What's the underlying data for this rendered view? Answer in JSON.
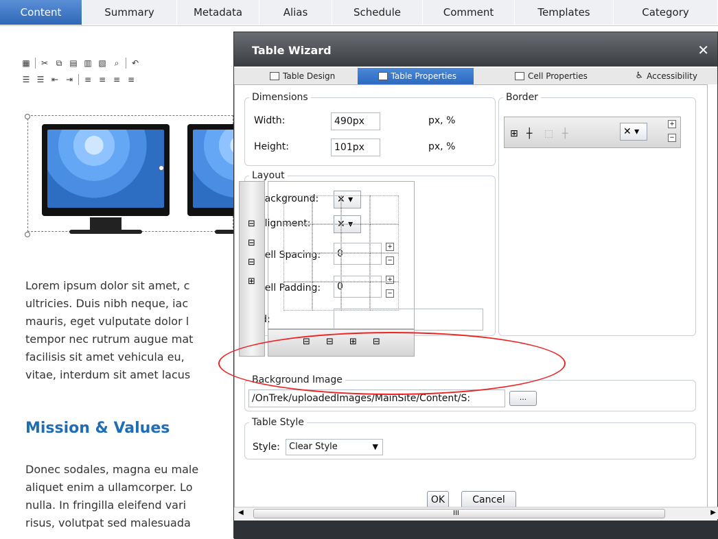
{
  "tabs": [
    "Content",
    "Summary",
    "Metadata",
    "Alias",
    "Schedule",
    "Comment",
    "Templates",
    "Category"
  ],
  "editor": {
    "paragraph1": [
      "Lorem ipsum dolor sit amet, c",
      "ultricies. Duis nibh neque, iac",
      "mauris, eget vulputate dolor l",
      "tempor nec rutrum augue mat",
      "facilisis sit amet vehicula eu,",
      "vitae, interdum sit amet lacus"
    ],
    "heading": "Mission & Values",
    "paragraph2": [
      "Donec sodales, magna eu male",
      "aliquet enim a ullamcorper. Lo",
      "nulla. In fringilla eleifend vari",
      "risus, volutpat sed malesuada"
    ]
  },
  "dialog": {
    "title": "Table Wizard",
    "close": "✕",
    "tabs": [
      "Table Design",
      "Table Properties",
      "Cell Properties",
      "Accessibility"
    ],
    "dimensions": {
      "legend": "Dimensions",
      "width_label": "Width:",
      "width_value": "490px",
      "width_unit": "px, %",
      "height_label": "Height:",
      "height_value": "101px",
      "height_unit": "px, %"
    },
    "layout": {
      "legend": "Layout",
      "background_label": "Background:",
      "alignment_label": "Alignment:",
      "spacing_label": "Cell Spacing:",
      "spacing_value": "0",
      "padding_label": "Cell Padding:",
      "padding_value": "0",
      "id_label": "Id:",
      "id_value": ""
    },
    "border": {
      "legend": "Border"
    },
    "background_image": {
      "legend": "Background Image",
      "value": "/OnTrek/uploadedImages/MainSite/Content/S:",
      "browse": "..."
    },
    "table_style": {
      "legend": "Table Style",
      "label": "Style:",
      "value": "Clear Style"
    },
    "ok": "OK",
    "cancel": "Cancel",
    "scroll_grip": "III"
  },
  "colors": {
    "accent": "#2f68b8",
    "highlight": "#e22222",
    "heading": "#1f6db6"
  }
}
